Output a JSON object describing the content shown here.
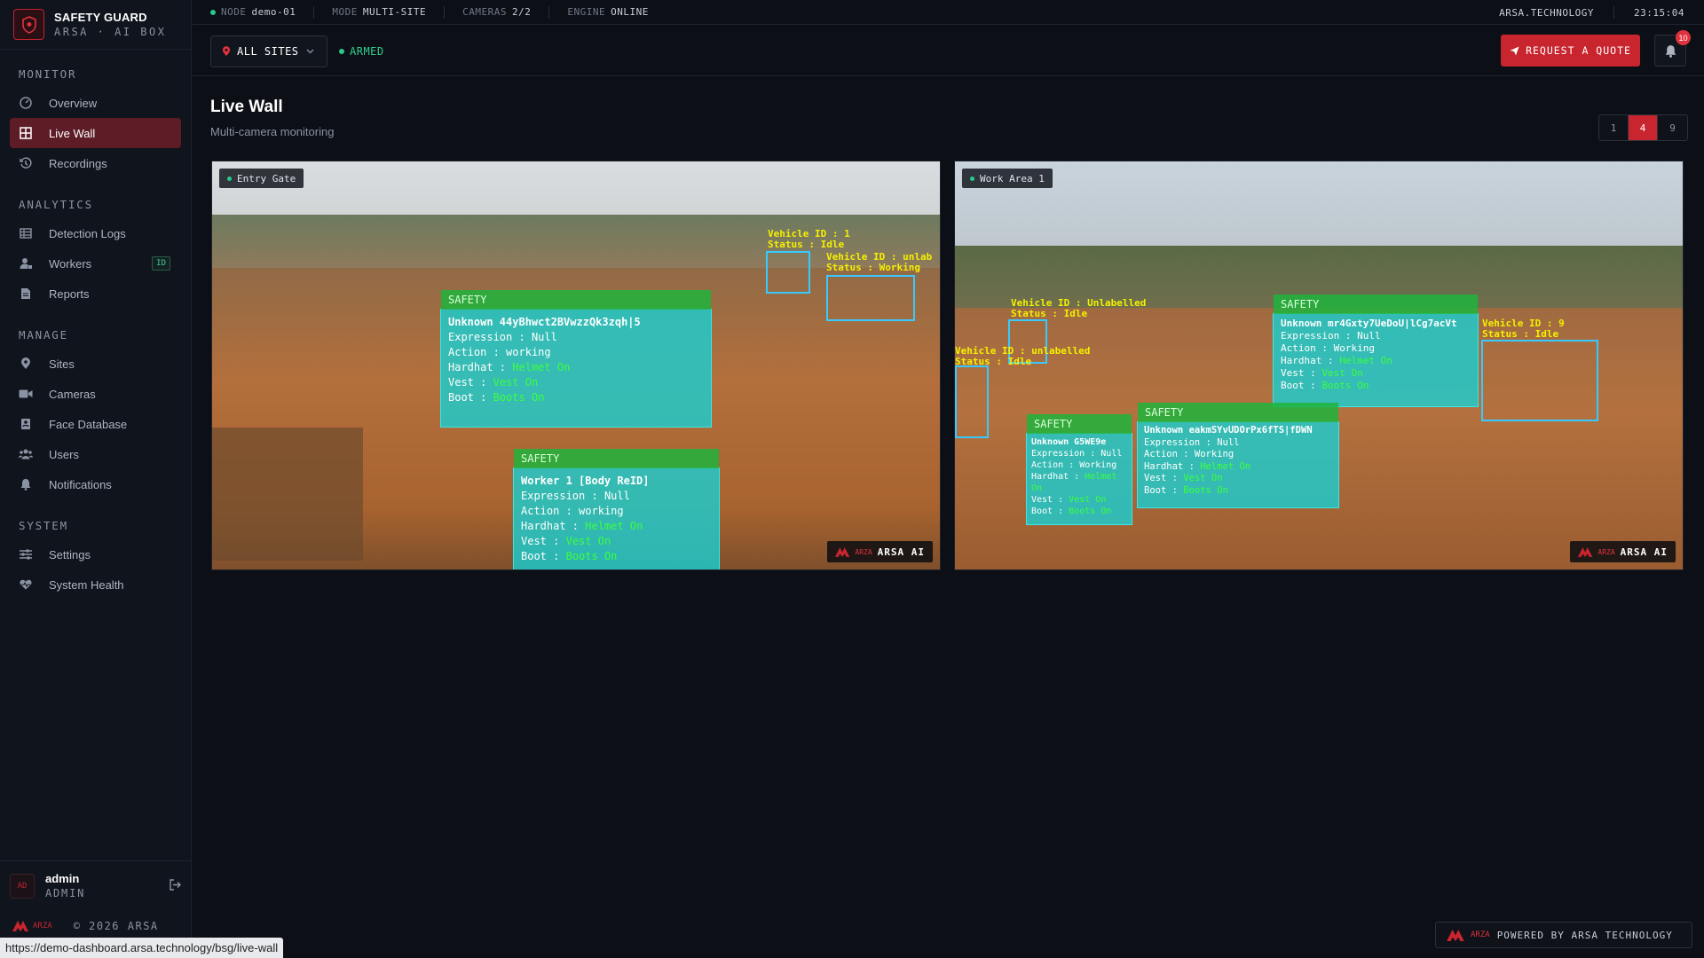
{
  "brand": {
    "title": "SAFETY GUARD",
    "subtitle": "ARSA · AI BOX"
  },
  "topbar": {
    "node_label": "NODE",
    "node_value": "demo-01",
    "mode_label": "MODE",
    "mode_value": "MULTI-SITE",
    "cameras_label": "CAMERAS",
    "cameras_value": "2/2",
    "engine_label": "ENGINE",
    "engine_value": "ONLINE",
    "domain": "ARSA.TECHNOLOGY",
    "clock": "23:15:04"
  },
  "sidebar": {
    "sections": {
      "monitor": "MONITOR",
      "analytics": "ANALYTICS",
      "manage": "MANAGE",
      "system": "SYSTEM"
    },
    "items": {
      "overview": "Overview",
      "live_wall": "Live Wall",
      "recordings": "Recordings",
      "detection_logs": "Detection Logs",
      "workers": "Workers",
      "workers_badge": "ID",
      "reports": "Reports",
      "sites": "Sites",
      "cameras": "Cameras",
      "face_database": "Face Database",
      "users": "Users",
      "notifications": "Notifications",
      "settings": "Settings",
      "system_health": "System Health"
    },
    "user": {
      "initials": "AD",
      "name": "admin",
      "role": "ADMIN"
    },
    "copyright": "© 2026 ARSA",
    "logo_text": "ARZA"
  },
  "toolbar": {
    "site_select": "ALL SITES",
    "armed_label": "ARMED",
    "quote_button": "REQUEST A QUOTE",
    "notification_count": "10"
  },
  "main": {
    "title": "Live Wall",
    "subtitle": "Multi-camera monitoring",
    "grid_options": [
      "1",
      "4",
      "9"
    ],
    "grid_selected": "4"
  },
  "cameras": [
    {
      "name": "Entry Gate",
      "watermark_small": "ARZA",
      "watermark": "ARSA AI",
      "detections": [
        {
          "header": "SAFETY",
          "name": "Unknown 44yBhwct2BVwzzQk3zqh|5",
          "expression": "Null",
          "action": "working",
          "hardhat": "Helmet On",
          "vest": "Vest On",
          "boot": "Boots On"
        },
        {
          "header": "SAFETY",
          "name": "Worker 1 [Body ReID]",
          "expression": "Null",
          "action": "working",
          "hardhat": "Helmet On",
          "vest": "Vest On",
          "boot": "Boots On"
        }
      ],
      "vehicle_labels": [
        "Vehicle ID : 1",
        "Status : Idle",
        "Vehicle ID : unlab",
        "Status : Working"
      ]
    },
    {
      "name": "Work Area 1",
      "watermark_small": "ARZA",
      "watermark": "ARSA AI",
      "detections": [
        {
          "header": "SAFETY",
          "name": "Unknown mr4Gxty7UeDoU|lCg7acVt",
          "expression": "Null",
          "action": "Working",
          "hardhat": "Helmet On",
          "vest": "Vest On",
          "boot": "Boots On"
        },
        {
          "header": "SAFETY",
          "name": "Unknown G5WE9e",
          "expression": "Null",
          "action": "Working",
          "hardhat": "Helmet On",
          "vest": "Vest On",
          "boot": "Boots On"
        },
        {
          "header": "SAFETY",
          "name": "Unknown eakmSYvUDOrPx6fTS|fDWN",
          "expression": "Null",
          "action": "Working",
          "hardhat": "Helmet On",
          "vest": "Vest On",
          "boot": "Boots On"
        }
      ],
      "vehicle_labels": [
        "Vehicle ID : Unlabelled",
        "Status : Idle",
        "Vehicle ID : unlabelled",
        "Status : Idle",
        "Vehicle ID : 9",
        "Status : Idle"
      ]
    }
  ],
  "field_labels": {
    "expression": "Expression",
    "action": "Action",
    "hardhat": "Hardhat",
    "vest": "Vest",
    "boot": "Boot"
  },
  "footer": {
    "powered_small": "ARZA",
    "powered": "POWERED BY ARSA TECHNOLOGY"
  },
  "status_url": "https://demo-dashboard.arsa.technology/bsg/live-wall",
  "colors": {
    "accent": "#c8252f",
    "online": "#29c98a",
    "background": "#0c0f15",
    "sidebar": "#10141c"
  }
}
